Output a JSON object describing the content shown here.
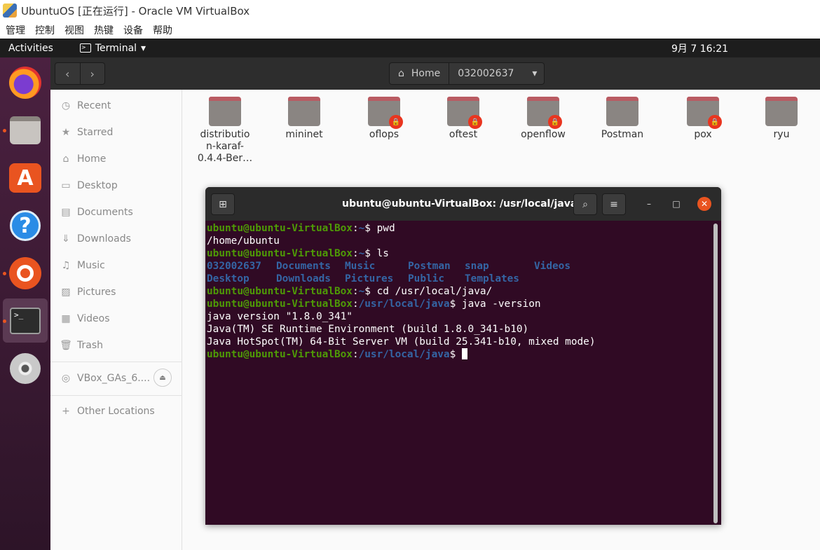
{
  "vbox": {
    "title": "UbuntuOS [正在运行] - Oracle VM VirtualBox",
    "menu": [
      "管理",
      "控制",
      "视图",
      "热键",
      "设备",
      "帮助"
    ]
  },
  "topbar": {
    "activities": "Activities",
    "app": "Terminal",
    "clock": "9月 7  16:21"
  },
  "fm": {
    "path_home": "Home",
    "path_current": "032002637",
    "sidebar": [
      "Recent",
      "Starred",
      "Home",
      "Desktop",
      "Documents",
      "Downloads",
      "Music",
      "Pictures",
      "Videos",
      "Trash"
    ],
    "device": "VBox_GAs_6....",
    "other": "Other Locations",
    "folders": [
      "distributio\nn-karaf-\n0.4.4-Ber…",
      "mininet",
      "oflops",
      "oftest",
      "openflow",
      "Postman",
      "pox",
      "ryu"
    ]
  },
  "terminal": {
    "title": "ubuntu@ubuntu-VirtualBox: /usr/local/java",
    "prompt_user": "ubuntu@ubuntu-VirtualBox",
    "lines": {
      "l1_path": "~",
      "l1_cmd": " pwd",
      "l2": "/home/ubuntu",
      "l3_path": "~",
      "l3_cmd": " ls",
      "ls_row1": [
        "032002637",
        "Documents",
        "Music",
        "Postman",
        "snap",
        "Videos"
      ],
      "ls_row2": [
        "Desktop",
        "Downloads",
        "Pictures",
        "Public",
        "Templates"
      ],
      "l6_path": "~",
      "l6_cmd": " cd /usr/local/java/",
      "l7_path": "/usr/local/java",
      "l7_cmd": " java -version",
      "l8": "java version \"1.8.0_341\"",
      "l9": "Java(TM) SE Runtime Environment (build 1.8.0_341-b10)",
      "l10": "Java HotSpot(TM) 64-Bit Server VM (build 25.341-b10, mixed mode)",
      "l11_path": "/usr/local/java"
    }
  }
}
